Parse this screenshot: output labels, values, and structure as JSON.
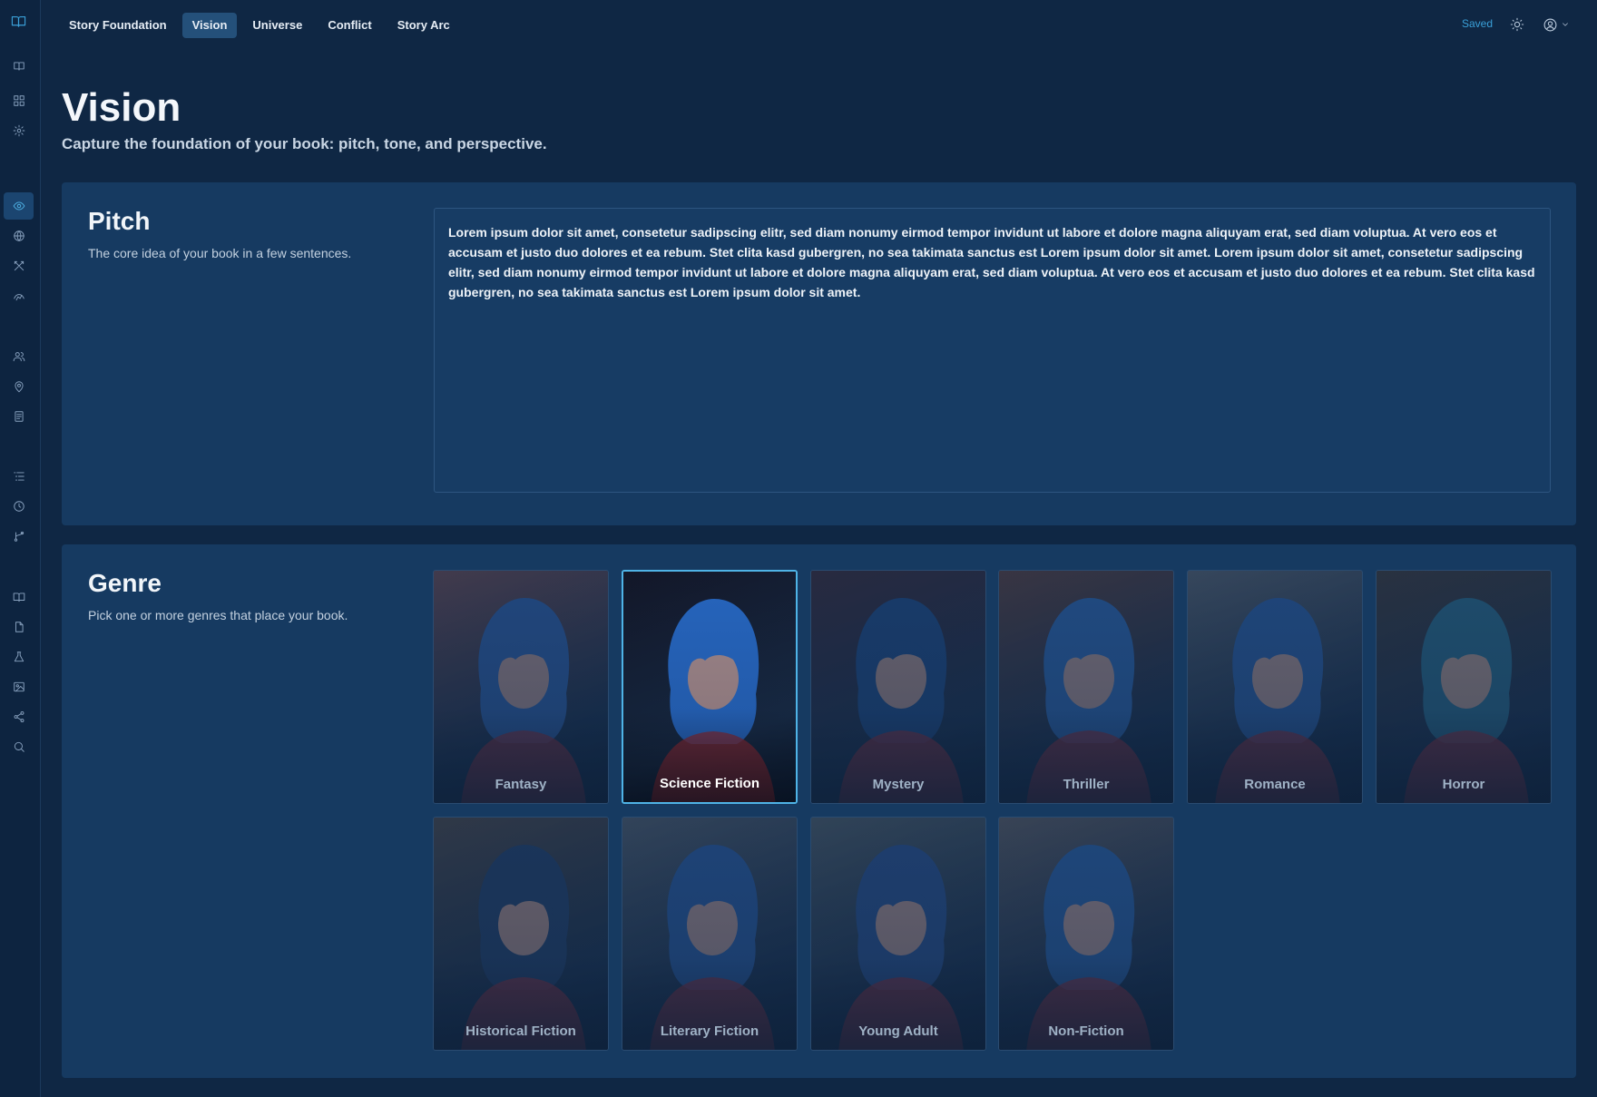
{
  "nav": {
    "tabs": [
      {
        "label": "Story Foundation",
        "active": false
      },
      {
        "label": "Vision",
        "active": true
      },
      {
        "label": "Universe",
        "active": false
      },
      {
        "label": "Conflict",
        "active": false
      },
      {
        "label": "Story Arc",
        "active": false
      }
    ],
    "status": "Saved"
  },
  "header": {
    "title": "Vision",
    "subtitle": "Capture the foundation of your book: pitch, tone, and perspective."
  },
  "pitch": {
    "title": "Pitch",
    "description": "The core idea of your book in a few sentences.",
    "text": "Lorem ipsum dolor sit amet, consetetur sadipscing elitr, sed diam nonumy eirmod tempor invidunt ut labore et dolore magna aliquyam erat, sed diam voluptua. At vero eos et accusam et justo duo dolores et ea rebum. Stet clita kasd gubergren, no sea takimata sanctus est Lorem ipsum dolor sit amet. Lorem ipsum dolor sit amet, consetetur sadipscing elitr, sed diam nonumy eirmod tempor invidunt ut labore et dolore magna aliquyam erat, sed diam voluptua. At vero eos et accusam et justo duo dolores et ea rebum. Stet clita kasd gubergren, no sea takimata sanctus est Lorem ipsum dolor sit amet."
  },
  "genre": {
    "title": "Genre",
    "description": "Pick one or more genres that place your book.",
    "options": [
      {
        "label": "Fantasy",
        "selected": false,
        "bg": "#6b4a52",
        "accent": "#2f5fa8"
      },
      {
        "label": "Science Fiction",
        "selected": true,
        "bg": "#14182a",
        "accent": "#2a6fd0"
      },
      {
        "label": "Mystery",
        "selected": false,
        "bg": "#3c2b3a",
        "accent": "#1f4a86"
      },
      {
        "label": "Thriller",
        "selected": false,
        "bg": "#5a4040",
        "accent": "#2e66b0"
      },
      {
        "label": "Romance",
        "selected": false,
        "bg": "#56606e",
        "accent": "#2c5ea4"
      },
      {
        "label": "Horror",
        "selected": false,
        "bg": "#3e3a3c",
        "accent": "#2a6a8a"
      },
      {
        "label": "Historical Fiction",
        "selected": false,
        "bg": "#4a4648",
        "accent": "#24406a"
      },
      {
        "label": "Literary Fiction",
        "selected": false,
        "bg": "#4e5a6a",
        "accent": "#2a5aa0"
      },
      {
        "label": "Young Adult",
        "selected": false,
        "bg": "#4c5a66",
        "accent": "#2a508e"
      },
      {
        "label": "Non-Fiction",
        "selected": false,
        "bg": "#5a5a62",
        "accent": "#2b60a6"
      }
    ]
  }
}
